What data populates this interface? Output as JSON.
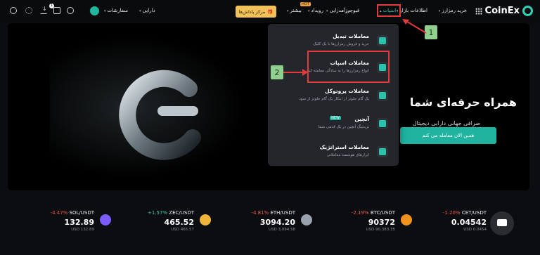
{
  "nav": {
    "brand": "CoinEx",
    "items": [
      {
        "label": "خرید رمزارز"
      },
      {
        "label": "اطلاعات بازار"
      },
      {
        "label": "اسپات"
      },
      {
        "label": "فیوچرز"
      },
      {
        "label": "درآمدزایی"
      },
      {
        "label": "رویداد"
      },
      {
        "label": "بیشتر"
      }
    ],
    "hot_badge": "HOT",
    "reward_label": "مرکز پاداش‌ها",
    "orders_label": "سفارشات",
    "assets_label": "دارایی",
    "notification_count": "1"
  },
  "dropdown": {
    "items": [
      {
        "title": "معاملات تبدیل",
        "desc": "خرید و فروش رمزارزها با یک کلیک"
      },
      {
        "title": "معاملات اسپات",
        "desc": "انواع رمزارزها را به سادگی معامله کنید"
      },
      {
        "title": "معاملات پروتوکل",
        "desc": "یک گام جلوتر از ابتکار یک گام جلوتر از سود"
      },
      {
        "title": "آنچین",
        "desc": "تریدینگ آنچین در یک قدمی شما",
        "tag": "NEW"
      },
      {
        "title": "معاملات استراتژیک",
        "desc": "ابزارهای هوشمند معاملاتی"
      }
    ]
  },
  "hero": {
    "title": "همراه حرفه‌ای شما",
    "subtitle": "صرافی جهانی دارایی دیجیتال",
    "cta": "همین الان معامله می کنم"
  },
  "annotations": {
    "step1": "1",
    "step2": "2"
  },
  "tickers": [
    {
      "symbol": "SOL/USDT",
      "change": "-4.47%",
      "price": "132.89",
      "usd": "USD 132.89",
      "color": "#7b5cff"
    },
    {
      "symbol": "ZEC/USDT",
      "change": "+1.57%",
      "price": "465.52",
      "usd": "USD 465.57",
      "color": "#f0b43c"
    },
    {
      "symbol": "ETH/USDT",
      "change": "-4.81%",
      "price": "3094.20",
      "usd": "USD 3,094.58",
      "color": "#9aa3ad"
    },
    {
      "symbol": "BTC/USDT",
      "change": "-2.19%",
      "price": "90372",
      "usd": "USD 90,383.35",
      "color": "#f2931f"
    },
    {
      "symbol": "CET/USDT",
      "change": "-1.20%",
      "price": "0.04542",
      "usd": "USD 0.0454",
      "color": "#27c3ad"
    }
  ],
  "colors": {
    "accent": "#1fb3a0",
    "negative": "#f0574f",
    "positive": "#2fd1a0",
    "highlight": "#e13b3b"
  }
}
